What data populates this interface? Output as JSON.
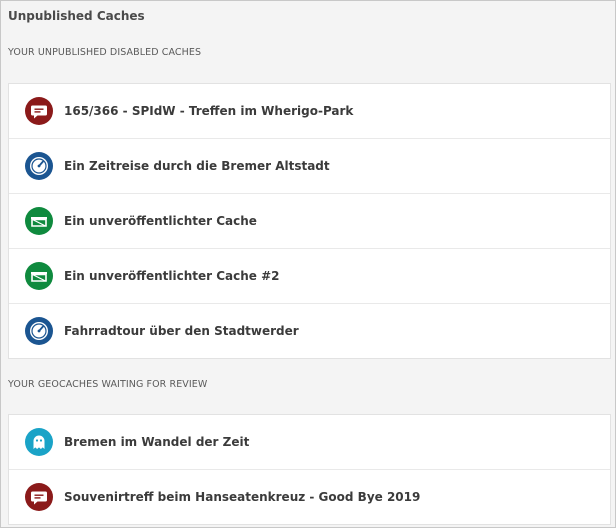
{
  "page": {
    "title": "Unpublished Caches"
  },
  "sections": [
    {
      "label": "YOUR UNPUBLISHED DISABLED CACHES",
      "items": [
        {
          "name": "165/366 - SPIdW - Treffen im Wherigo-Park",
          "icon": "event-cache-icon",
          "color": "#8b1a1a"
        },
        {
          "name": "Ein Zeitreise durch die Bremer Altstadt",
          "icon": "wherigo-cache-icon",
          "color": "#1b5591"
        },
        {
          "name": "Ein unveröffentlichter Cache",
          "icon": "traditional-cache-icon",
          "color": "#0f8a3e"
        },
        {
          "name": "Ein unveröffentlichter Cache #2",
          "icon": "traditional-cache-icon",
          "color": "#0f8a3e"
        },
        {
          "name": "Fahrradtour über den Stadtwerder",
          "icon": "wherigo-cache-icon",
          "color": "#1b5591"
        }
      ]
    },
    {
      "label": "YOUR GEOCACHES WAITING FOR REVIEW",
      "items": [
        {
          "name": "Bremen im Wandel der Zeit",
          "icon": "ghost-cache-icon",
          "color": "#1aa3c7"
        },
        {
          "name": "Souvenirtreff beim Hanseatenkreuz - Good Bye 2019",
          "icon": "event-cache-icon",
          "color": "#8b1a1a"
        }
      ]
    }
  ]
}
